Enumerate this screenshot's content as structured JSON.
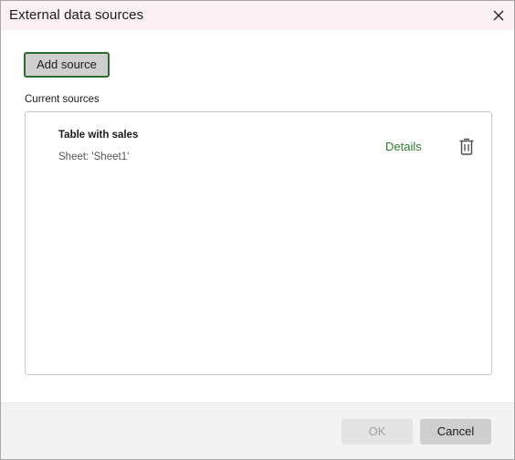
{
  "dialog": {
    "title": "External data sources"
  },
  "toolbar": {
    "add_source_label": "Add source"
  },
  "sources": {
    "section_label": "Current sources",
    "items": [
      {
        "name": "Table with sales",
        "sheet": "Sheet: 'Sheet1'",
        "details_label": "Details",
        "delete_icon": "trash-icon"
      }
    ]
  },
  "footer": {
    "ok_label": "OK",
    "ok_enabled": false,
    "cancel_label": "Cancel"
  },
  "colors": {
    "titlebar_bg": "#fbf1f4",
    "accent_green": "#2f7d32",
    "focus_border": "#2e6b2e",
    "footer_bg": "#f3f3f3"
  }
}
